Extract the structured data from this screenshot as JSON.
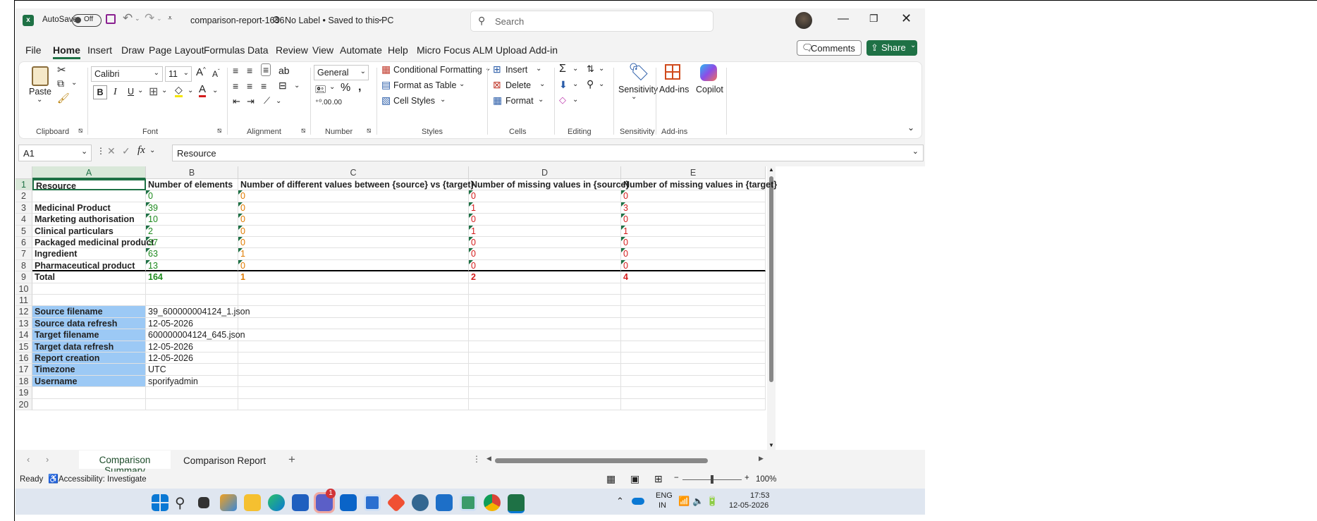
{
  "title_bar": {
    "autosave_label": "AutoSave",
    "autosave_state": "Off",
    "document_title": "comparison-report-1636",
    "label_status": "No Label • Saved to this PC",
    "search_placeholder": "Search"
  },
  "menu": {
    "tabs": [
      "File",
      "Home",
      "Insert",
      "Draw",
      "Page Layout",
      "Formulas",
      "Data",
      "Review",
      "View",
      "Automate",
      "Help",
      "Micro Focus ALM Upload Add-in"
    ],
    "active_tab": "Home",
    "comments_label": "Comments",
    "share_label": "Share"
  },
  "ribbon": {
    "clipboard": {
      "paste": "Paste",
      "group": "Clipboard"
    },
    "font": {
      "name": "Calibri",
      "size": "11",
      "group": "Font",
      "bold": "B",
      "italic": "I",
      "underline": "U"
    },
    "alignment": {
      "group": "Alignment"
    },
    "number": {
      "format": "General",
      "group": "Number"
    },
    "styles": {
      "conditional": "Conditional Formatting",
      "format_table": "Format as Table",
      "cell_styles": "Cell Styles",
      "group": "Styles"
    },
    "cells": {
      "insert": "Insert",
      "delete": "Delete",
      "format": "Format",
      "group": "Cells"
    },
    "editing": {
      "group": "Editing"
    },
    "sensitivity": {
      "label": "Sensitivity",
      "group": "Sensitivity"
    },
    "addins": {
      "label": "Add-ins",
      "group": "Add-ins"
    },
    "copilot": {
      "label": "Copilot"
    }
  },
  "formula_bar": {
    "name_box": "A1",
    "content": "Resource"
  },
  "columns": [
    "A",
    "B",
    "C",
    "D",
    "E"
  ],
  "rows": [
    {
      "n": "1",
      "a": "Resource",
      "b": "Number of elements",
      "c": "Number of different values between {source} vs {target}",
      "d": "Number of missing values in {source}",
      "e": "Number of missing values in {target}"
    },
    {
      "n": "2",
      "a": "",
      "b": "0",
      "c": "0",
      "d": "0",
      "e": "0"
    },
    {
      "n": "3",
      "a": "Medicinal Product",
      "b": "39",
      "c": "0",
      "d": "1",
      "e": "3"
    },
    {
      "n": "4",
      "a": "Marketing authorisation",
      "b": "10",
      "c": "0",
      "d": "0",
      "e": "0"
    },
    {
      "n": "5",
      "a": "Clinical particulars",
      "b": "2",
      "c": "0",
      "d": "1",
      "e": "1"
    },
    {
      "n": "6",
      "a": "Packaged medicinal product",
      "b": "37",
      "c": "0",
      "d": "0",
      "e": "0"
    },
    {
      "n": "7",
      "a": "Ingredient",
      "b": "63",
      "c": "1",
      "d": "0",
      "e": "0"
    },
    {
      "n": "8",
      "a": "Pharmaceutical product",
      "b": "13",
      "c": "0",
      "d": "0",
      "e": "0"
    },
    {
      "n": "9",
      "a": "Total",
      "b": "164",
      "c": "1",
      "d": "2",
      "e": "4"
    },
    {
      "n": "10",
      "a": "",
      "b": ""
    },
    {
      "n": "11",
      "a": "",
      "b": ""
    },
    {
      "n": "12",
      "a": "Source filename",
      "b": "39_600000004124_1.json"
    },
    {
      "n": "13",
      "a": "Source data refresh",
      "b": "12-05-2026"
    },
    {
      "n": "14",
      "a": "Target filename",
      "b": "600000004124_645.json"
    },
    {
      "n": "15",
      "a": "Target data refresh",
      "b": "12-05-2026"
    },
    {
      "n": "16",
      "a": "Report creation",
      "b": "12-05-2026"
    },
    {
      "n": "17",
      "a": "Timezone",
      "b": "UTC"
    },
    {
      "n": "18",
      "a": "Username",
      "b": "sporifyadmin"
    },
    {
      "n": "19",
      "a": "",
      "b": ""
    },
    {
      "n": "20",
      "a": "",
      "b": ""
    }
  ],
  "sheet_tabs": {
    "active": "Comparison Summary",
    "other": "Comparison Report",
    "add": "+"
  },
  "status_bar": {
    "ready": "Ready",
    "accessibility": "Accessibility: Investigate",
    "zoom": "100%"
  },
  "taskbar": {
    "lang": "ENG",
    "region": "IN",
    "time": "17:53",
    "date": "12-05-2026",
    "teams_badge": "1"
  },
  "colors": {
    "excel_green": "#1e7145",
    "selected_label_bg": "#9cc9f5",
    "value_green": "#1e8a1e",
    "value_orange": "#e07b00",
    "value_red": "#d41c1c"
  }
}
